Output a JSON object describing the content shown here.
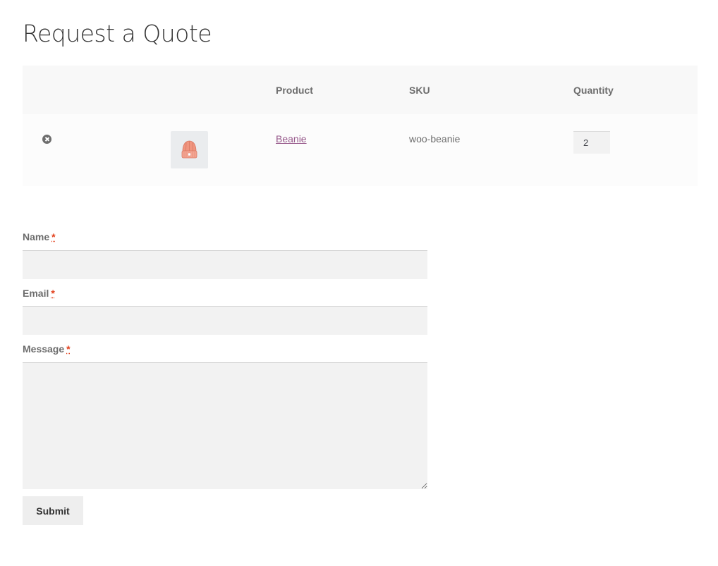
{
  "page": {
    "title": "Request a Quote"
  },
  "table": {
    "headers": {
      "product": "Product",
      "sku": "SKU",
      "quantity": "Quantity"
    },
    "rows": [
      {
        "product": "Beanie",
        "sku": "woo-beanie",
        "quantity": "2",
        "thumbnail_icon": "beanie-icon"
      }
    ],
    "remove_icon": "remove-circle-icon"
  },
  "form": {
    "name_label": "Name",
    "email_label": "Email",
    "message_label": "Message",
    "required_marker": "*",
    "name_value": "",
    "email_value": "",
    "message_value": "",
    "submit_label": "Submit"
  },
  "colors": {
    "link": "#96588a",
    "required": "#e2401c",
    "field_bg": "#f2f2f2",
    "header_bg": "#f8f8f8"
  }
}
